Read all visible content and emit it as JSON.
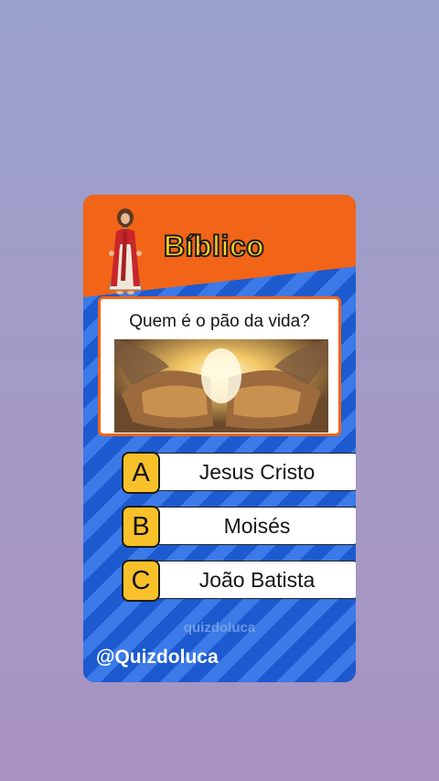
{
  "quiz": {
    "category": "Bíblico",
    "question": "Quem é o pão da vida?",
    "options": [
      {
        "letter": "A",
        "text": "Jesus Cristo"
      },
      {
        "letter": "B",
        "text": "Moisés"
      },
      {
        "letter": "C",
        "text": "João Batista"
      }
    ],
    "watermark": "quizdoluca",
    "handle": "@Quizdoluca"
  },
  "icons": {
    "category_icon": "jesus-figure-icon",
    "question_image": "bread-breaking-image"
  },
  "colors": {
    "header_orange": "#f26417",
    "card_blue": "#1d5ad0",
    "badge_yellow": "#f8c12a",
    "title_yellow": "#ffd21f"
  }
}
